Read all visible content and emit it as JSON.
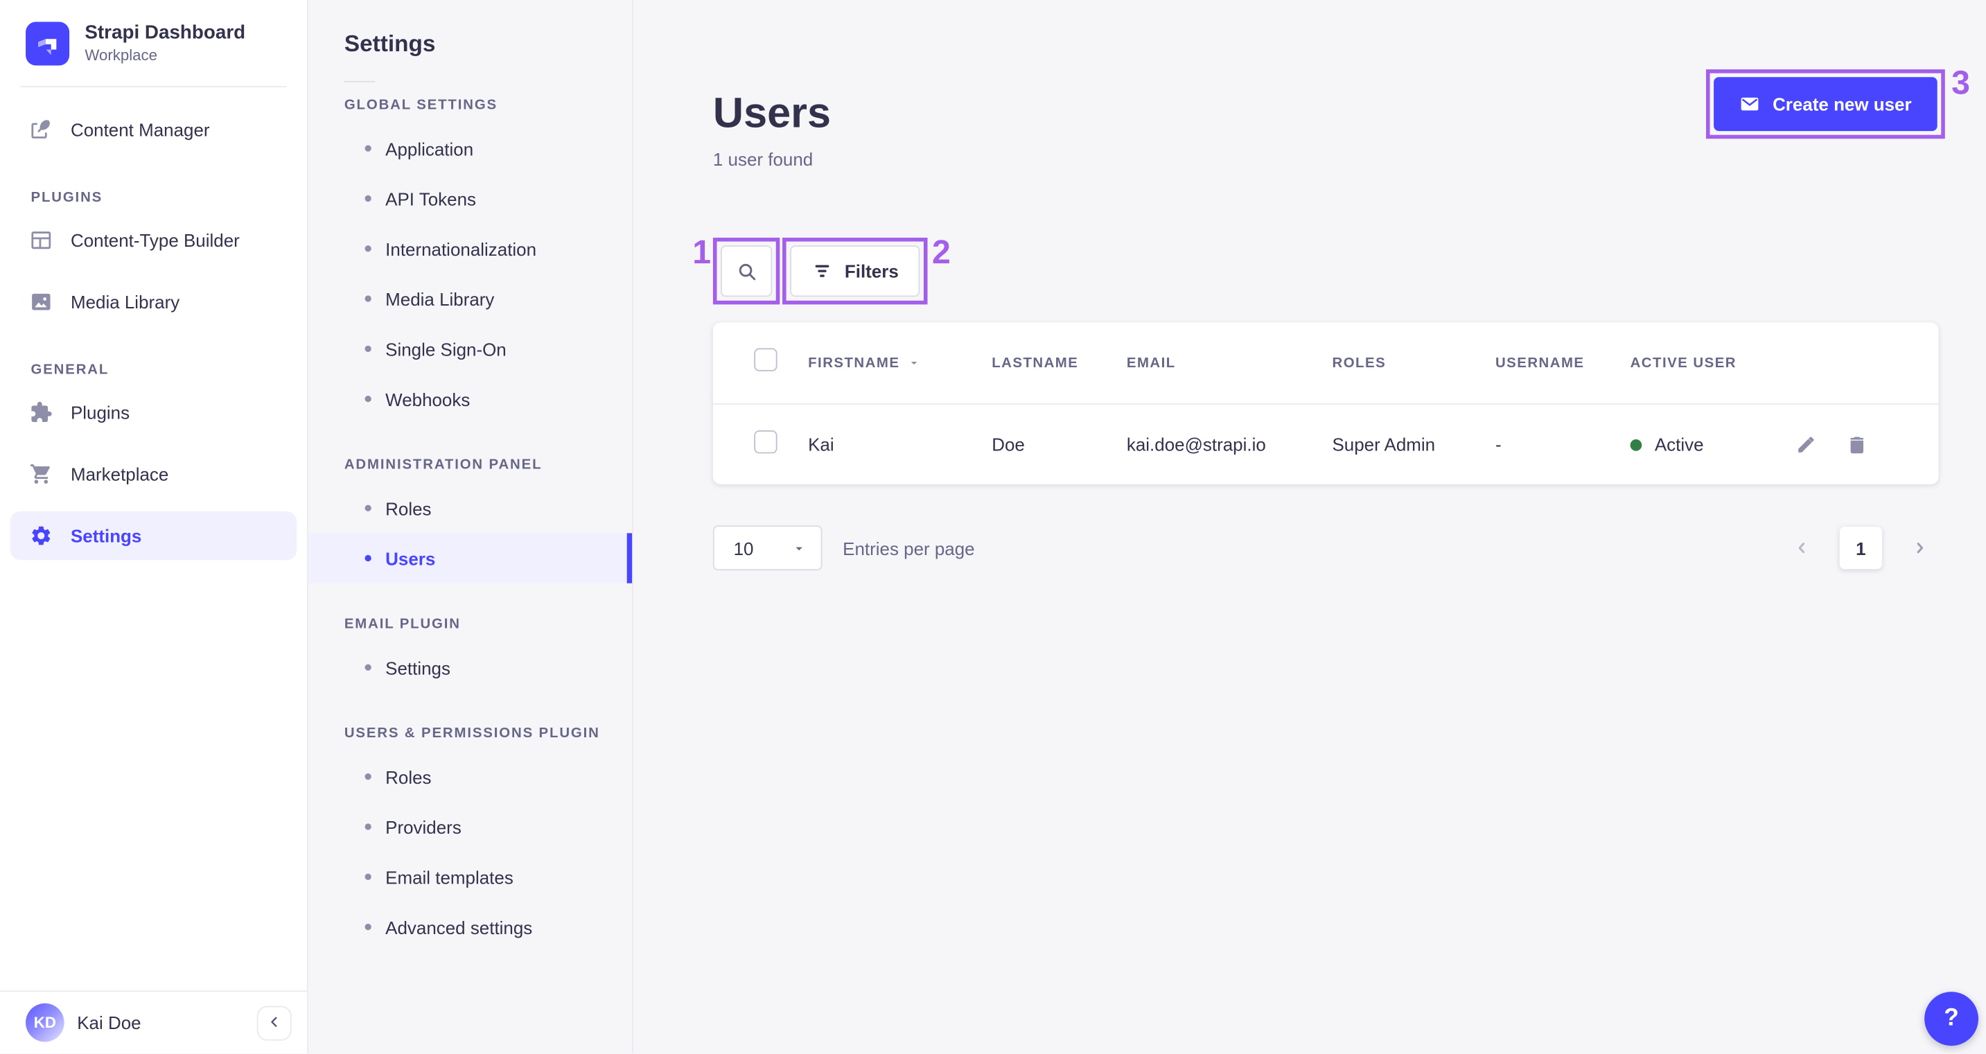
{
  "colors": {
    "primary": "#4945ff",
    "primary_light": "#f0f0ff",
    "annotation": "#a35fe9",
    "success": "#328048",
    "text_dark": "#32324d",
    "text_muted": "#666687"
  },
  "brand": {
    "title": "Strapi Dashboard",
    "subtitle": "Workplace"
  },
  "main_nav": {
    "content_manager": "Content Manager",
    "sections": [
      {
        "label": "PLUGINS",
        "items": [
          "Content-Type Builder",
          "Media Library"
        ]
      },
      {
        "label": "GENERAL",
        "items": [
          "Plugins",
          "Marketplace",
          "Settings"
        ]
      }
    ],
    "user": {
      "initials": "KD",
      "name": "Kai Doe"
    }
  },
  "subnav": {
    "title": "Settings",
    "sections": [
      {
        "label": "GLOBAL SETTINGS",
        "items": [
          "Application",
          "API Tokens",
          "Internationalization",
          "Media Library",
          "Single Sign-On",
          "Webhooks"
        ]
      },
      {
        "label": "ADMINISTRATION PANEL",
        "items": [
          "Roles",
          "Users"
        ]
      },
      {
        "label": "EMAIL PLUGIN",
        "items": [
          "Settings"
        ]
      },
      {
        "label": "USERS & PERMISSIONS PLUGIN",
        "items": [
          "Roles",
          "Providers",
          "Email templates",
          "Advanced settings"
        ]
      }
    ],
    "active_item": "Users"
  },
  "header": {
    "title": "Users",
    "subtitle": "1 user found",
    "create_button": "Create new user"
  },
  "toolbar": {
    "filters_label": "Filters"
  },
  "table": {
    "columns": [
      "FIRSTNAME",
      "LASTNAME",
      "EMAIL",
      "ROLES",
      "USERNAME",
      "ACTIVE USER"
    ],
    "rows": [
      {
        "firstname": "Kai",
        "lastname": "Doe",
        "email": "kai.doe@strapi.io",
        "roles": "Super Admin",
        "username": "-",
        "active_label": "Active"
      }
    ]
  },
  "pagination": {
    "page_size": "10",
    "entries_label": "Entries per page",
    "page": "1"
  },
  "help": {
    "label": "?"
  },
  "annotations": [
    {
      "n": "1"
    },
    {
      "n": "2"
    },
    {
      "n": "3"
    }
  ]
}
